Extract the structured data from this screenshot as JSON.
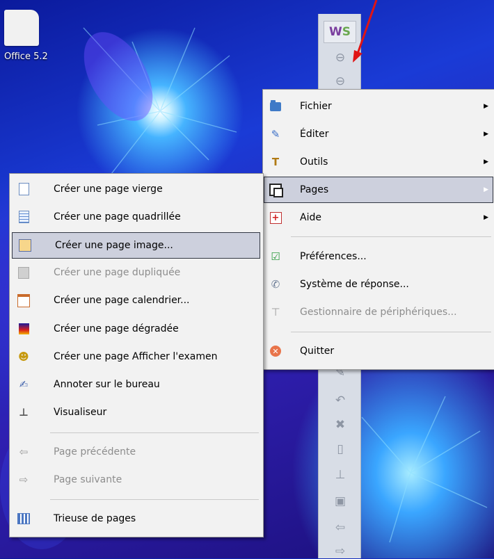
{
  "desktop": {
    "icon_label": "Office 5.2"
  },
  "toolbar": {
    "logo_w": "W",
    "logo_s": "S",
    "buttons": [
      "minimize-icon",
      "collapse-icon",
      "pen-icon",
      "undo-icon",
      "delete-icon",
      "new-page-icon",
      "visualizer-icon",
      "screen-capture-icon",
      "previous-arrow-icon",
      "next-arrow-icon"
    ]
  },
  "main_menu": {
    "items": [
      {
        "label": "Fichier",
        "icon": "folder-icon",
        "submenu": true
      },
      {
        "label": "Éditer",
        "icon": "edit-icon",
        "submenu": true
      },
      {
        "label": "Outils",
        "icon": "tools-icon",
        "submenu": true
      },
      {
        "label": "Pages",
        "icon": "pages-icon",
        "submenu": true,
        "selected": true
      },
      {
        "label": "Aide",
        "icon": "help-icon",
        "submenu": true
      },
      {
        "label": "Préférences...",
        "icon": "preferences-icon"
      },
      {
        "label": "Système de réponse...",
        "icon": "response-system-icon"
      },
      {
        "label": "Gestionnaire de périphériques...",
        "icon": "device-manager-icon",
        "disabled": true
      },
      {
        "label": "Quitter",
        "icon": "quit-icon"
      }
    ]
  },
  "pages_submenu": {
    "items": [
      {
        "label": "Créer une page vierge",
        "icon": "blank-page-icon"
      },
      {
        "label": "Créer une page quadrillée",
        "icon": "grid-page-icon"
      },
      {
        "label": "Créer une page image...",
        "icon": "image-page-icon",
        "selected": true
      },
      {
        "label": "Créer une page dupliquée",
        "icon": "duplicate-page-icon",
        "disabled": true
      },
      {
        "label": "Créer une page calendrier...",
        "icon": "calendar-page-icon"
      },
      {
        "label": "Créer une page dégradée",
        "icon": "gradient-page-icon"
      },
      {
        "label": "Créer une page Afficher l'examen",
        "icon": "exam-page-icon"
      },
      {
        "label": "Annoter sur le bureau",
        "icon": "annotate-desktop-icon"
      },
      {
        "label": "Visualiseur",
        "icon": "visualizer-icon"
      },
      {
        "label": "Page précédente",
        "icon": "previous-page-icon",
        "disabled": true
      },
      {
        "label": "Page suivante",
        "icon": "next-page-icon",
        "disabled": true
      },
      {
        "label": "Trieuse de pages",
        "icon": "page-sorter-icon"
      }
    ]
  },
  "colors": {
    "annotation_arrow": "#e01414",
    "selection": "#cdd0dd"
  }
}
